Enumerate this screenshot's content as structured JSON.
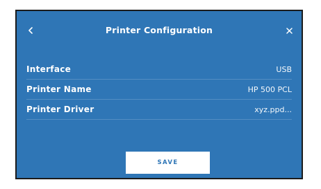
{
  "dialog": {
    "title": "Printer Configuration",
    "back_icon": "chevron-left-icon",
    "close_icon": "close-icon"
  },
  "rows": [
    {
      "label": "Interface",
      "value": "USB"
    },
    {
      "label": "Printer Name",
      "value": "HP 500 PCL"
    },
    {
      "label": "Printer Driver",
      "value": "xyz.ppd..."
    }
  ],
  "actions": {
    "save_label": "SAVE"
  },
  "colors": {
    "panel_background": "#2f76b6",
    "text": "#ffffff",
    "button_background": "#ffffff",
    "button_text": "#2f76b6"
  }
}
